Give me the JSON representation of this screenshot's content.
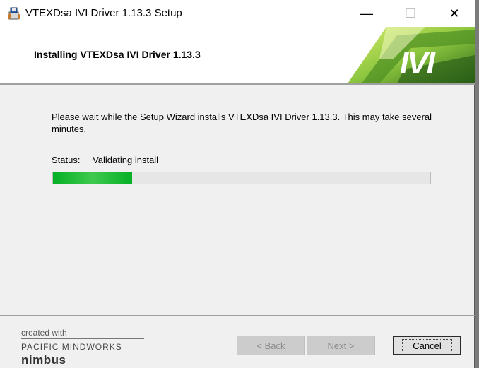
{
  "window": {
    "title": "VTEXDsa IVI Driver 1.13.3 Setup",
    "controls": {
      "minimize": "—",
      "maximize": "☐",
      "close": "✕"
    }
  },
  "banner": {
    "heading": "Installing VTEXDsa IVI Driver 1.13.3",
    "logo_text": "IVI"
  },
  "body": {
    "description": "Please wait while the Setup Wizard installs VTEXDsa IVI Driver 1.13.3.  This may take several minutes.",
    "status_label": "Status:",
    "status_value": "Validating install",
    "progress_fraction": 0.21
  },
  "footer": {
    "created_with": "created with",
    "company": "PACIFIC MINDWORKS",
    "product": "nimbus",
    "buttons": {
      "back": "< Back",
      "next": "Next >",
      "cancel": "Cancel"
    }
  },
  "colors": {
    "progress_green": "#06b025",
    "banner_green": "#8dc63f"
  }
}
